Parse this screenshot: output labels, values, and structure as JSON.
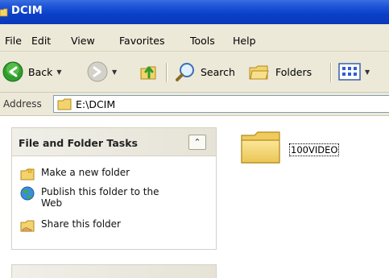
{
  "window": {
    "title": "DCIM"
  },
  "menu": [
    "File",
    "Edit",
    "View",
    "Favorites",
    "Tools",
    "Help"
  ],
  "toolbar": {
    "back_label": "Back",
    "search_label": "Search",
    "folders_label": "Folders"
  },
  "address": {
    "label": "Address",
    "value": "E:\\DCIM"
  },
  "task_pane": {
    "title": "File and Folder Tasks",
    "collapse_glyph": "⌃",
    "tasks": [
      {
        "label": "Make a new folder",
        "icon": "new-folder-icon"
      },
      {
        "label": "Publish this folder to the Web",
        "icon": "publish-web-icon"
      },
      {
        "label": "Share this folder",
        "icon": "share-folder-icon"
      }
    ]
  },
  "files": [
    {
      "name": "100VIDEO",
      "icon": "folder-icon",
      "selected": true
    }
  ]
}
